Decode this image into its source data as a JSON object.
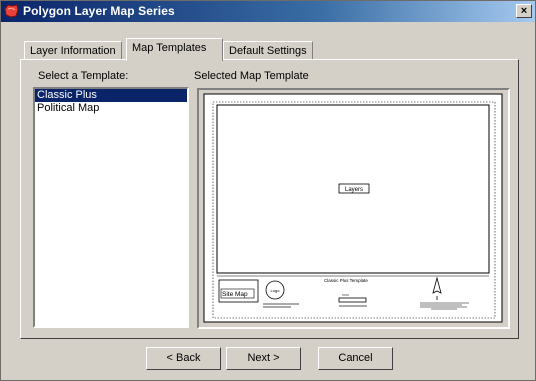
{
  "window": {
    "title": "Polygon Layer Map Series",
    "close_label": "×"
  },
  "tabs": [
    {
      "label": "Layer Information",
      "active": false
    },
    {
      "label": "Map Templates",
      "active": true
    },
    {
      "label": "Default Settings",
      "active": false
    }
  ],
  "template_list": {
    "label": "Select a Template:",
    "items": [
      {
        "label": "Classic Plus",
        "selected": true
      },
      {
        "label": "Political Map",
        "selected": false
      }
    ]
  },
  "preview": {
    "label": "Selected Map Template",
    "layers_label": "Layers",
    "site_map_label": "Site Map",
    "logo_label": "Logo",
    "template_title": "Classic Plus Template"
  },
  "buttons": {
    "back": "< Back",
    "next": "Next >",
    "cancel": "Cancel"
  },
  "colors": {
    "titlebar_start": "#0a246a",
    "titlebar_end": "#a6caf0",
    "selection": "#0a246a",
    "face": "#d4d0c8"
  }
}
